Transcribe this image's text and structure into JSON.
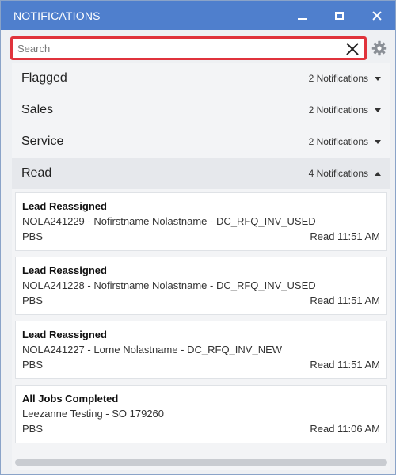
{
  "window": {
    "title": "NOTIFICATIONS",
    "minimize_icon": "minimize-icon",
    "maximize_icon": "maximize-icon",
    "close_icon": "close-icon"
  },
  "search": {
    "placeholder": "Search",
    "value": "",
    "clear_icon": "close-icon",
    "settings_icon": "gear-icon",
    "highlight_color": "#e0333c"
  },
  "groups": [
    {
      "name": "Flagged",
      "count": "2 Notifications",
      "state": "collapsed"
    },
    {
      "name": "Sales",
      "count": "2 Notifications",
      "state": "collapsed"
    },
    {
      "name": "Service",
      "count": "2 Notifications",
      "state": "collapsed"
    },
    {
      "name": "Read",
      "count": "4 Notifications",
      "state": "expanded"
    }
  ],
  "read_items": [
    {
      "title": "Lead Reassigned",
      "detail": "NOLA241229 - Nofirstname Nolastname - DC_RFQ_INV_USED",
      "source": "PBS",
      "time": "Read 11:51 AM"
    },
    {
      "title": "Lead Reassigned",
      "detail": "NOLA241228 - Nofirstname Nolastname - DC_RFQ_INV_USED",
      "source": "PBS",
      "time": "Read 11:51 AM"
    },
    {
      "title": "Lead Reassigned",
      "detail": "NOLA241227 - Lorne Nolastname - DC_RFQ_INV_NEW",
      "source": "PBS",
      "time": "Read 11:51 AM"
    },
    {
      "title": "All Jobs Completed",
      "detail": "Leezanne Testing - SO 179260",
      "source": "PBS",
      "time": "Read 11:06 AM"
    }
  ],
  "colors": {
    "titlebar": "#4f7fcd",
    "panel_bg": "#f3f4f6",
    "expanded_row_bg": "#e6e8ec"
  }
}
